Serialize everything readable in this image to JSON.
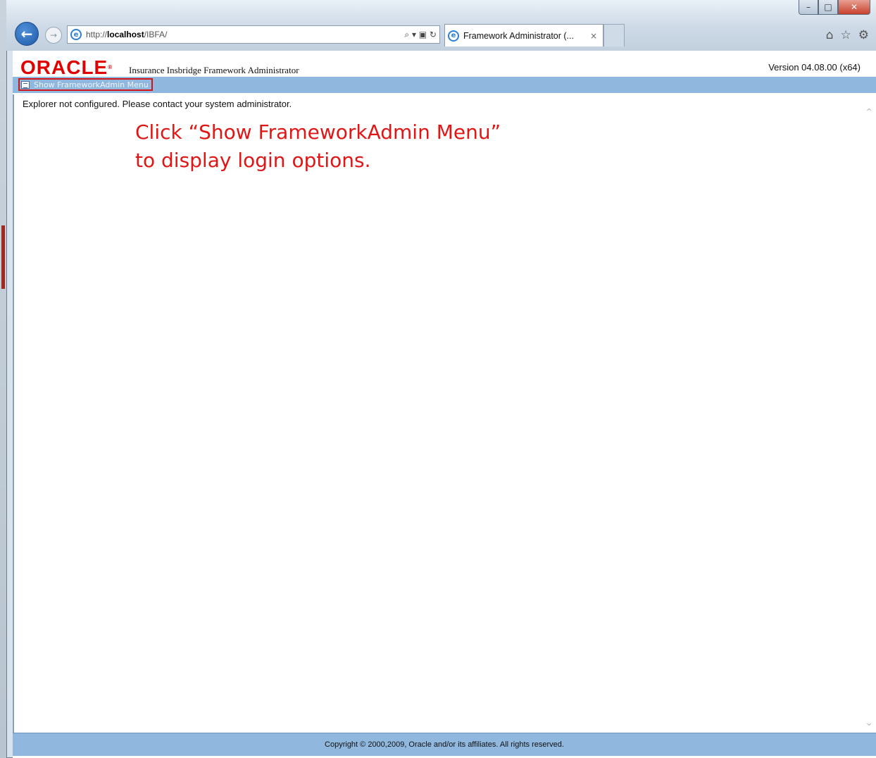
{
  "browser": {
    "url_prefix": "http://",
    "url_host": "localhost",
    "url_path": "/IBFA/",
    "tab_title": "Framework Administrator (...",
    "tab_close": "×",
    "search_tools": "⌕ ▾ ▣ ↻",
    "window_controls": {
      "minimize": "–",
      "maximize": "□",
      "close": "✕"
    },
    "toolbar_icons": [
      "home-icon",
      "star-icon",
      "gear-icon"
    ]
  },
  "header": {
    "logo_text": "ORACLE",
    "product_name": "Insurance Insbridge Framework Administrator",
    "version": "Version 04.08.00 (x64)"
  },
  "menubar": {
    "show_menu_label": "Show FrameworkAdmin Menu"
  },
  "content": {
    "status_message": "Explorer not configured. Please contact your system administrator.",
    "annotation_line1": "Click “Show FrameworkAdmin Menu”",
    "annotation_line2": "to display login options."
  },
  "footer": {
    "copyright": "Copyright © 2000,2009, Oracle and/or its affiliates. All rights reserved."
  },
  "colors": {
    "menubar": "#90b7de",
    "oracle_red": "#e00000",
    "annotation_red": "#e01616"
  }
}
